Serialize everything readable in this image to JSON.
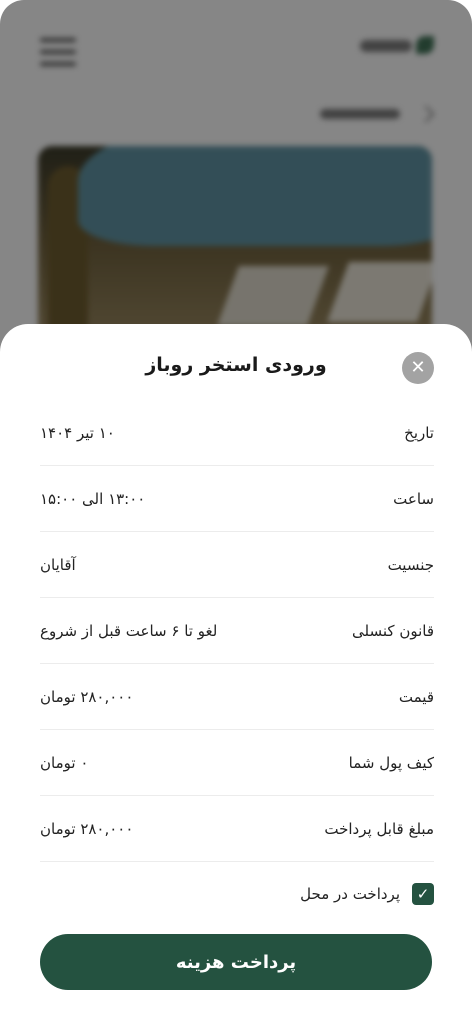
{
  "sheet": {
    "title": "ورودی استخر روباز",
    "close_icon": "close-icon"
  },
  "details": [
    {
      "label": "تاریخ",
      "value": "۱۰ تیر ۱۴۰۴"
    },
    {
      "label": "ساعت",
      "value": "۱۳:۰۰ الی ۱۵:۰۰"
    },
    {
      "label": "جنسیت",
      "value": "آقایان"
    },
    {
      "label": "قانون کنسلی",
      "value": "لغو تا ۶ ساعت قبل از شروع"
    },
    {
      "label": "قیمت",
      "value": "۲۸۰,۰۰۰ تومان"
    },
    {
      "label": "کیف پول شما",
      "value": "۰ تومان"
    },
    {
      "label": "مبلغ قابل پرداخت",
      "value": "۲۸۰,۰۰۰ تومان"
    }
  ],
  "pay_on_site": {
    "label": "پرداخت در محل",
    "checked": true
  },
  "pay_button": {
    "label": "پرداخت هزینه"
  },
  "colors": {
    "accent": "#245240",
    "close_bg": "#a3a3a3"
  }
}
